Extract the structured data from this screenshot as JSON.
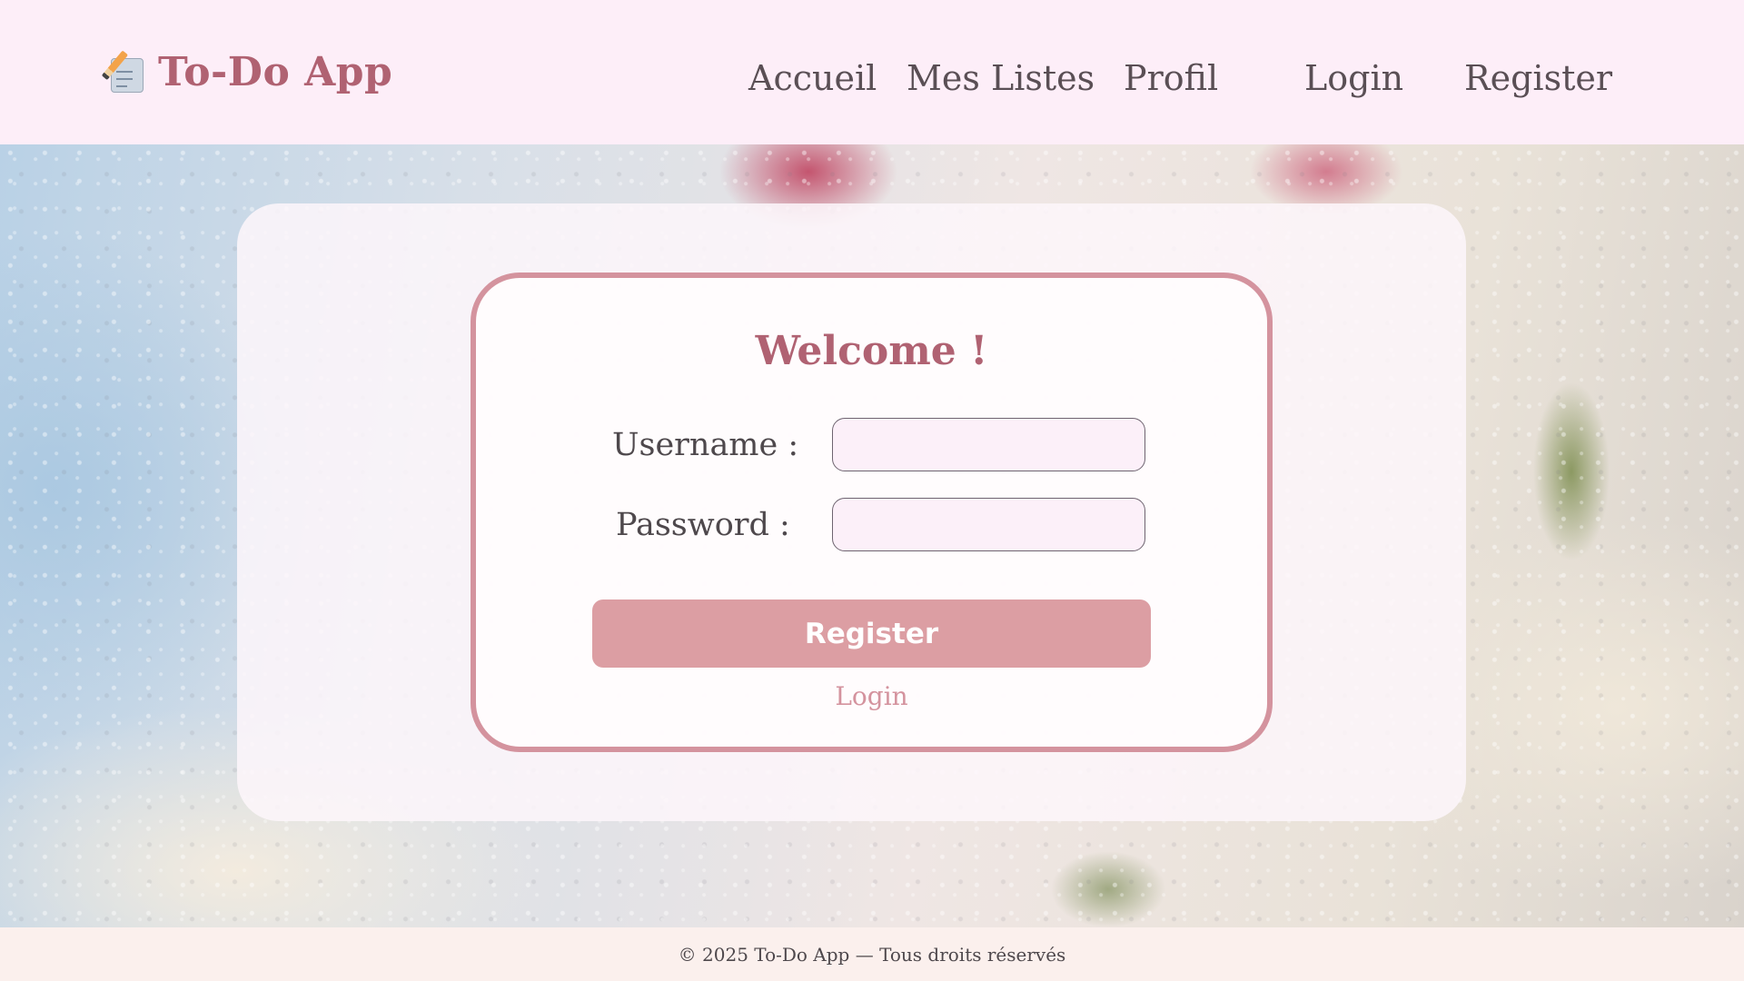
{
  "header": {
    "brand": "To-Do App",
    "brand_icon": "memo-pencil-icon",
    "nav": {
      "home": "Accueil",
      "lists": "Mes Listes",
      "profile": "Profil",
      "login": "Login",
      "register": "Register"
    }
  },
  "form": {
    "title": "Welcome !",
    "username_label": "Username :",
    "username_value": "",
    "password_label": "Password :",
    "password_value": "",
    "submit_label": "Register",
    "alt_link": "Login"
  },
  "footer": {
    "text": "© 2025 To-Do App — Tous droits réservés"
  },
  "colors": {
    "accent": "#b06272",
    "button": "#dc9ea3",
    "card_border": "#d4939e",
    "header_bg": "#fdeef8",
    "input_bg": "#fcf0f9"
  }
}
